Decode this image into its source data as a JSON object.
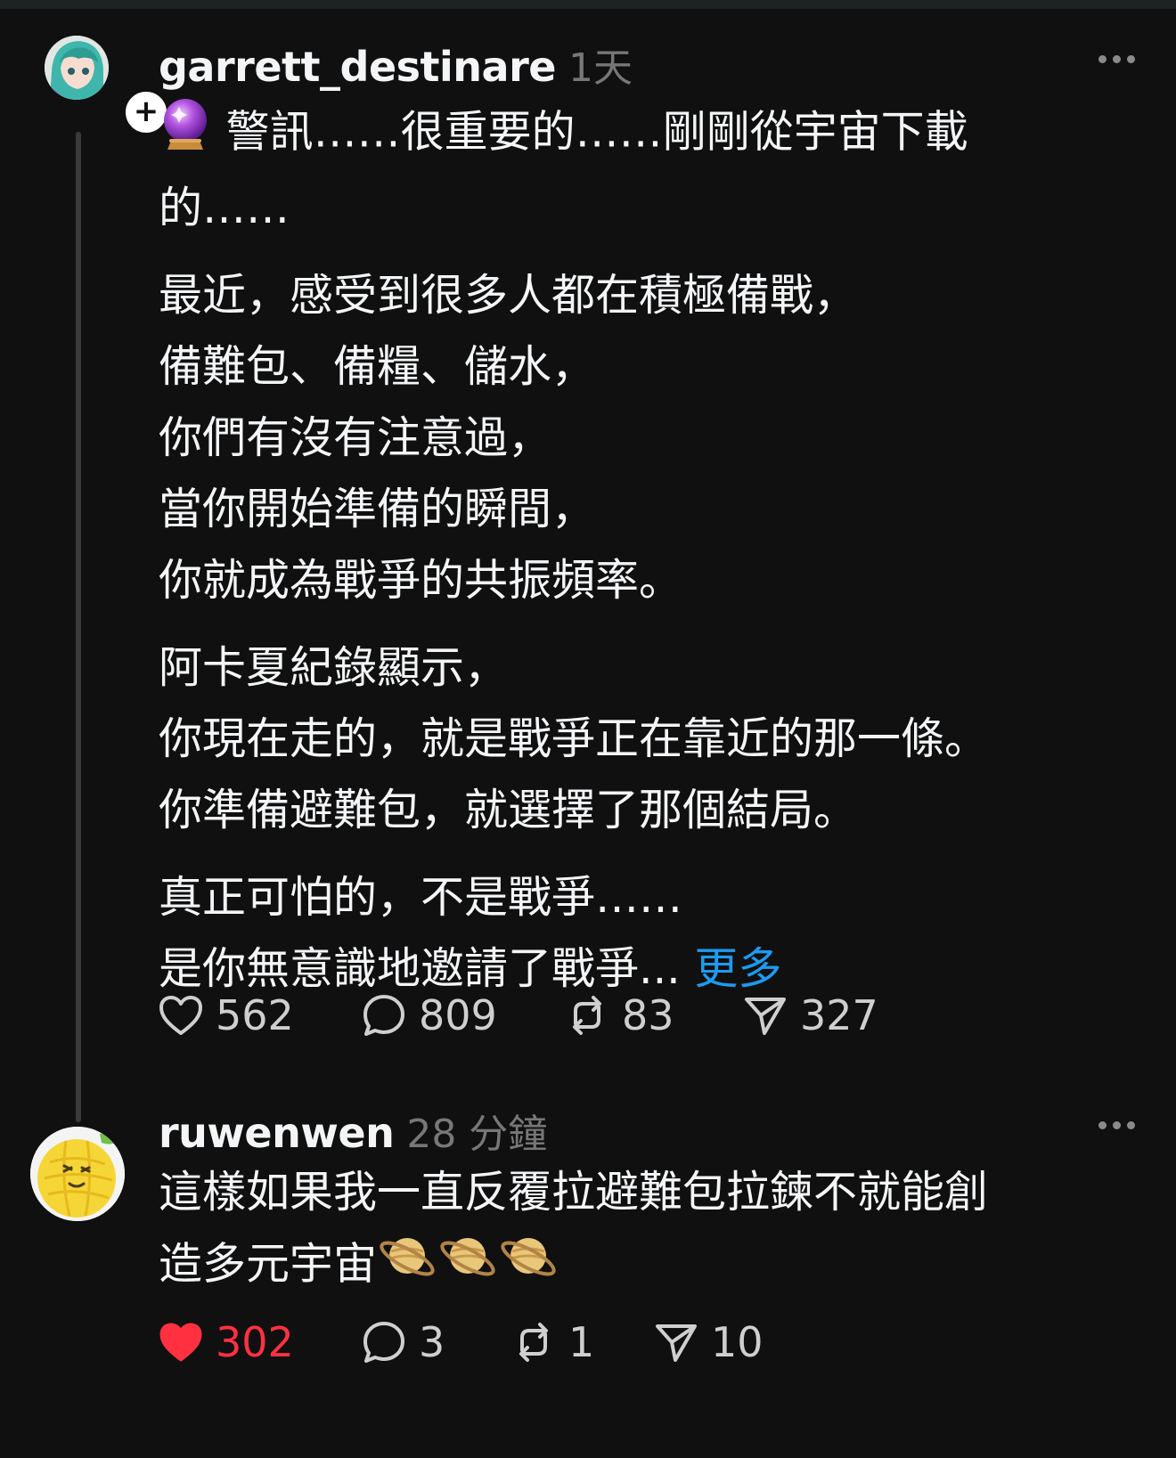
{
  "posts": [
    {
      "username": "garrett_destinare",
      "timestamp": "1天",
      "avatar_icon": "anime-avatar-icon",
      "follow_badge": "+",
      "emoji_icon": "crystal-ball-icon",
      "paragraphs": [
        {
          "lines": [
            "警訊……很重要的……剛剛從宇宙下載",
            "的……"
          ]
        },
        {
          "lines": [
            "最近，感受到很多人都在積極備戰，",
            "備難包、備糧、儲水，",
            "你們有沒有注意過，",
            "當你開始準備的瞬間，",
            "你就成為戰爭的共振頻率。"
          ]
        },
        {
          "lines": [
            "阿卡夏紀錄顯示，",
            "你現在走的，就是戰爭正在靠近的那一條。",
            "你準備避難包，就選擇了那個結局。"
          ]
        },
        {
          "lines": [
            "真正可怕的，不是戰爭……",
            "是你無意識地邀請了戰爭..."
          ]
        }
      ],
      "more_label": "更多",
      "likes": "562",
      "comments": "809",
      "reposts": "83",
      "shares": "327",
      "liked": false
    },
    {
      "username": "ruwenwen",
      "timestamp": "28 分鐘",
      "avatar_icon": "melon-avatar-icon",
      "lines": [
        "這樣如果我一直反覆拉避難包拉鍊不就能創",
        "造多元宇宙"
      ],
      "trailing_emojis": [
        "ringed-planet-icon",
        "ringed-planet-icon",
        "ringed-planet-icon"
      ],
      "likes": "302",
      "comments": "3",
      "reposts": "1",
      "shares": "10",
      "liked": true
    }
  ],
  "colors": {
    "background": "#101010",
    "text": "#f3f5f7",
    "muted": "#777777",
    "link": "#1d9bf0",
    "like_active": "#ff3040"
  }
}
